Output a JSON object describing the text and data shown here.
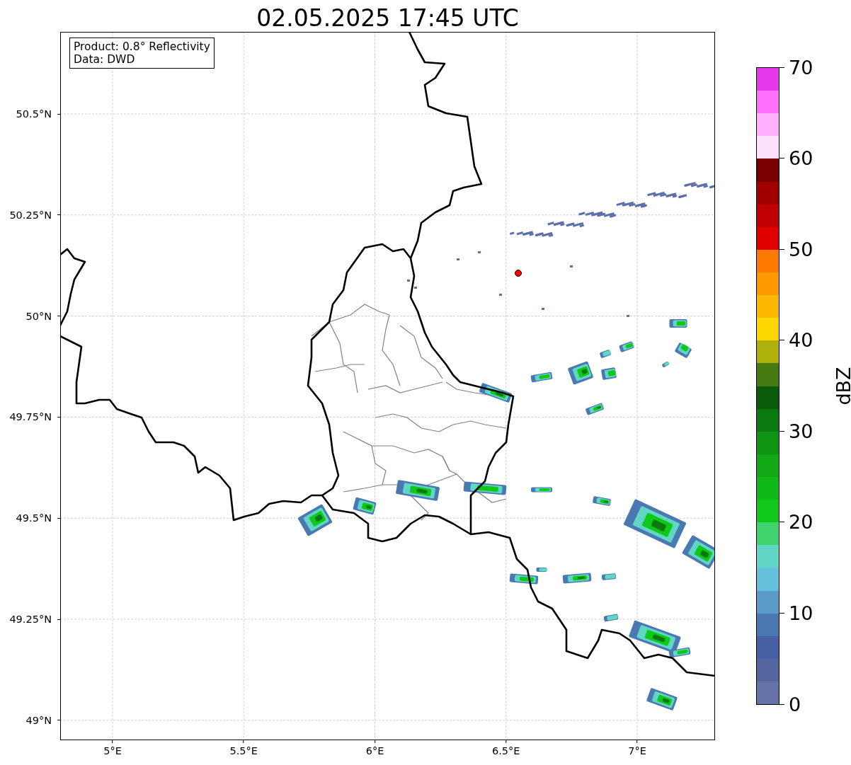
{
  "title": "02.05.2025 17:45 UTC",
  "info_box": {
    "lines": [
      "Product: 0.8° Reflectivity",
      "Data: DWD"
    ]
  },
  "map": {
    "xticks": [
      "5°E",
      "5.5°E",
      "6°E",
      "6.5°E",
      "7°E"
    ],
    "yticks": [
      "50.5°N",
      "50.25°N",
      "50°N",
      "49.75°N",
      "49.5°N",
      "49.25°N",
      "49°N"
    ]
  },
  "colorbar": {
    "label": "dBZ",
    "ticks": [
      "70",
      "60",
      "50",
      "40",
      "30",
      "20",
      "10",
      "0"
    ],
    "bins": [
      {
        "color": "#e838ee"
      },
      {
        "color": "#ff70ff"
      },
      {
        "color": "#ffb0ff"
      },
      {
        "color": "#ffe0ff"
      },
      {
        "color": "#780000"
      },
      {
        "color": "#a00000"
      },
      {
        "color": "#c00000"
      },
      {
        "color": "#e00000"
      },
      {
        "color": "#ff7a00"
      },
      {
        "color": "#ff9900"
      },
      {
        "color": "#ffb800"
      },
      {
        "color": "#ffd700"
      },
      {
        "color": "#b0b00a"
      },
      {
        "color": "#467a10"
      },
      {
        "color": "#0a5a0c"
      },
      {
        "color": "#0a7a10"
      },
      {
        "color": "#0e9412"
      },
      {
        "color": "#10a814"
      },
      {
        "color": "#10b818"
      },
      {
        "color": "#10c81a"
      },
      {
        "color": "#3fd46e"
      },
      {
        "color": "#62d6c4"
      },
      {
        "color": "#64c0dc"
      },
      {
        "color": "#5b9bc8"
      },
      {
        "color": "#4a78b0"
      },
      {
        "color": "#4560a4"
      },
      {
        "color": "#5466a0"
      },
      {
        "color": "#6473a8"
      }
    ]
  }
}
